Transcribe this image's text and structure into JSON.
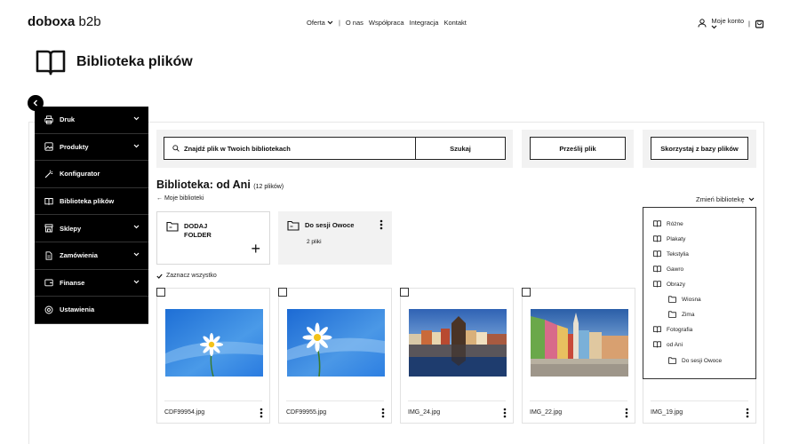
{
  "header": {
    "logo_bold": "doboxa",
    "logo_light": " b2b",
    "nav": {
      "offer": "Oferta",
      "about": "O nas",
      "cooperation": "Współpraca",
      "integration": "Integracja",
      "contact": "Kontakt"
    },
    "account": "Moje konto"
  },
  "page": {
    "title": "Biblioteka plików"
  },
  "sidebar": {
    "items": [
      {
        "label": "Druk",
        "icon": "printer-icon"
      },
      {
        "label": "Produkty",
        "icon": "image-icon"
      },
      {
        "label": "Konfigurator",
        "icon": "magic-wand-icon"
      },
      {
        "label": "Biblioteka plików",
        "icon": "book-icon"
      },
      {
        "label": "Sklepy",
        "icon": "store-icon"
      },
      {
        "label": "Zamówienia",
        "icon": "document-icon"
      },
      {
        "label": "Finanse",
        "icon": "wallet-icon"
      },
      {
        "label": "Ustawienia",
        "icon": "gear-icon"
      }
    ]
  },
  "search": {
    "placeholder": "Znajdź plik w Twoich bibliotekach",
    "button": "Szukaj"
  },
  "actions": {
    "upload": "Prześlij plik",
    "base": "Skorzystaj z bazy plików"
  },
  "library": {
    "title": "Biblioteka: od Ani",
    "count": "(12 plików)",
    "back": "Moje biblioteki",
    "change": "Zmień bibliotekę",
    "select_all": "Zaznacz wszystko"
  },
  "folders": {
    "add_line1": "DODAJ",
    "add_line2": "FOLDER",
    "owoce_name": "Do sesji Owoce",
    "owoce_count": "2 pliki"
  },
  "files": [
    {
      "name": "CDF99954.jpg"
    },
    {
      "name": "CDF99955.jpg"
    },
    {
      "name": "IMG_24.jpg"
    },
    {
      "name": "IMG_22.jpg"
    },
    {
      "name": "IMG_19.jpg"
    }
  ],
  "libraries_dropdown": [
    {
      "label": "Różne",
      "level": 0
    },
    {
      "label": "Plakaty",
      "level": 0
    },
    {
      "label": "Tekstylia",
      "level": 0
    },
    {
      "label": "Gawro",
      "level": 0
    },
    {
      "label": "Obrazy",
      "level": 0
    },
    {
      "label": "Wiosna",
      "level": 1
    },
    {
      "label": "Zima",
      "level": 1
    },
    {
      "label": "Fotografia",
      "level": 0
    },
    {
      "label": "od Ani",
      "level": 0
    },
    {
      "label": "Do sesji Owoce",
      "level": 1
    }
  ]
}
